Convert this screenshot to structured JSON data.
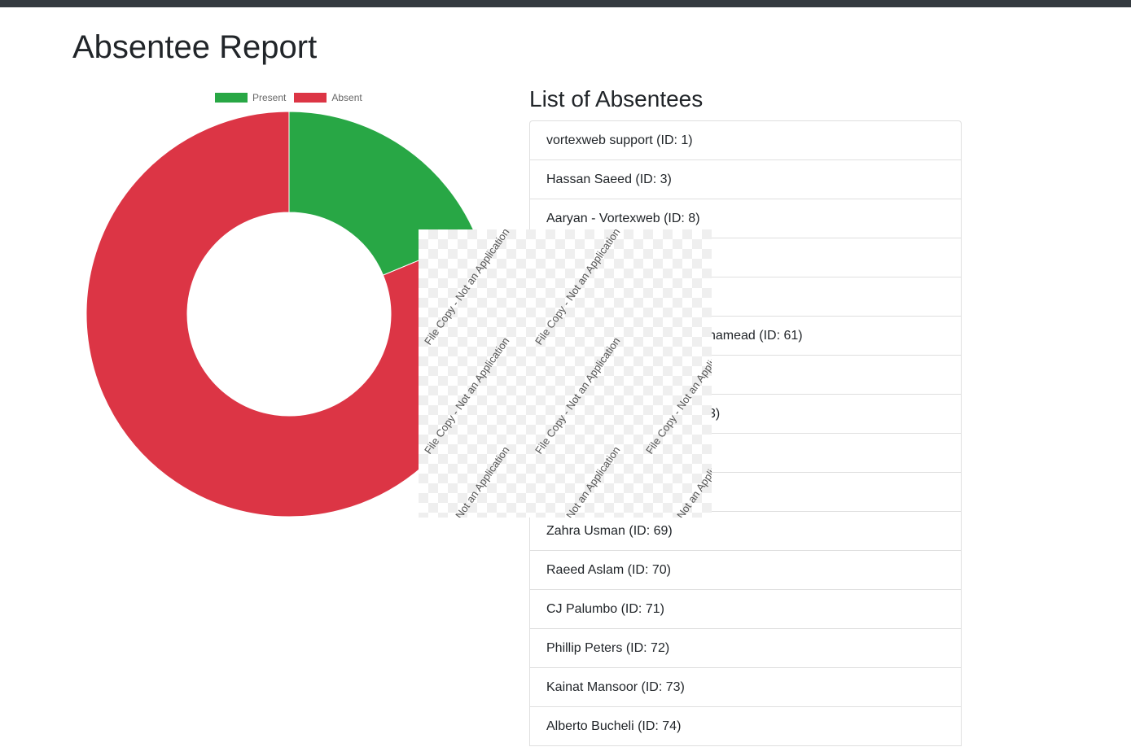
{
  "page": {
    "title": "Absentee Report"
  },
  "list": {
    "title": "List of Absentees",
    "items": [
      "vortexweb support (ID: 1)",
      "Hassan Saeed (ID: 3)",
      "Aaryan - Vortexweb (ID: 8)",
      "",
      "",
      "namead (ID: 61)",
      "",
      "3)",
      "",
      "",
      "Zahra Usman (ID: 69)",
      "Raeed Aslam (ID: 70)",
      "CJ Palumbo (ID: 71)",
      "Phillip Peters (ID: 72)",
      "Kainat Mansoor (ID: 73)",
      "Alberto Bucheli (ID: 74)"
    ]
  },
  "watermark": {
    "text": "File Copy - Not an Application"
  },
  "chart_data": {
    "type": "doughnut",
    "categories": [
      "Present",
      "Absent"
    ],
    "values": [
      3,
      13
    ],
    "colors": [
      "#28a745",
      "#dc3545"
    ],
    "legend": [
      "Present",
      "Absent"
    ],
    "legend_position": "top"
  }
}
